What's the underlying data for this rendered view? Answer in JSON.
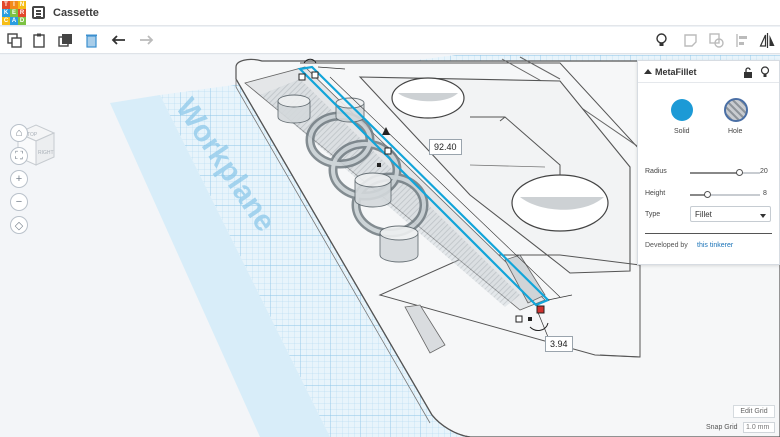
{
  "app": {
    "title": "Cassette",
    "logo_letters": [
      "T",
      "I",
      "N",
      "K",
      "E",
      "R",
      "C",
      "A",
      "D"
    ],
    "logo_colors": [
      "#e2482d",
      "#f28a1a",
      "#f6bd16",
      "#2a9ee0",
      "#7cc242",
      "#e2482d",
      "#f6bd16",
      "#2a9ee0",
      "#7cc242"
    ]
  },
  "toolbar": {
    "left_icons": [
      "copy-icon",
      "paste-icon",
      "duplicate-icon",
      "delete-icon",
      "undo-icon",
      "redo-icon"
    ],
    "right_icons": [
      "lightbulb-icon",
      "note-icon",
      "group-icon",
      "align-icon",
      "mirror-icon"
    ]
  },
  "viewport": {
    "workplane_label": "Workplane",
    "navcube_face": "RIGHT",
    "navcube_top": "TOP",
    "nav_buttons": [
      "home-icon",
      "fit-icon",
      "zoom-in-icon",
      "zoom-out-icon",
      "perspective-icon"
    ],
    "nav_glyphs": [
      "⌂",
      "⛶",
      "+",
      "−",
      "◇"
    ],
    "dimensions": {
      "length": "92.40",
      "height": "3.94"
    }
  },
  "panel": {
    "title": "MetaFillet",
    "solid_label": "Solid",
    "hole_label": "Hole",
    "radius_label": "Radius",
    "radius_value": "20",
    "radius_fraction": 0.72,
    "height_label": "Height",
    "height_value": "8",
    "height_fraction": 0.25,
    "type_label": "Type",
    "type_value": "Fillet",
    "developed_by": "Developed by",
    "developer": "this tinkerer"
  },
  "grid": {
    "edit_grid_label": "Edit Grid",
    "snap_grid_label": "Snap Grid",
    "snap_grid_value": "1.0 mm"
  },
  "colors": {
    "accent": "#1c9ad6",
    "selection": "#12a5d9",
    "workplane_grid": "#a7d4ee",
    "handle_red": "#d0312d"
  }
}
